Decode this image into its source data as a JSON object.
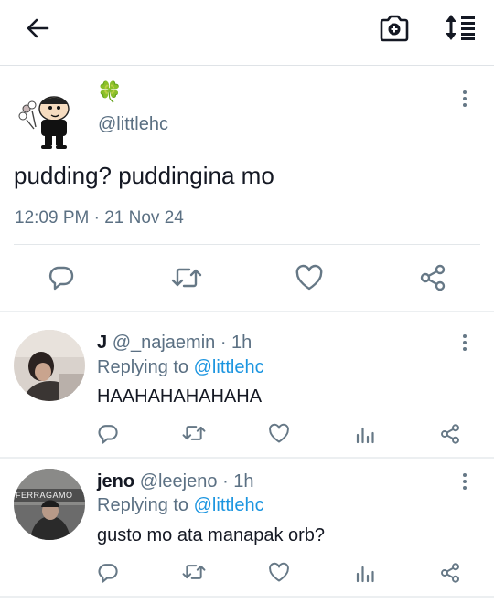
{
  "header": {
    "back_icon": "arrow-left-icon",
    "camera_icon": "camera-add-icon",
    "sort_icon": "sort-toggle-icon"
  },
  "tweet": {
    "author_emoji": "🍀",
    "handle": "@littlehc",
    "text": "pudding? puddingina mo",
    "time": "12:09 PM · 21 Nov 24"
  },
  "replies": [
    {
      "name": "J",
      "handle": "@_najaemin",
      "age": "· 1h",
      "replying_prefix": "Replying to",
      "replying_to": "@littlehc",
      "text": "HAAHAHAHAHAHA"
    },
    {
      "name": "jeno",
      "handle": "@leejeno",
      "age": "· 1h",
      "replying_prefix": "Replying to",
      "replying_to": "@littlehc",
      "text": "gusto mo ata manapak orb?",
      "avatar_text": "FERRAGAMO"
    }
  ],
  "colors": {
    "accent": "#1b95e0",
    "muted": "#5b7083",
    "icon": "#667886"
  }
}
